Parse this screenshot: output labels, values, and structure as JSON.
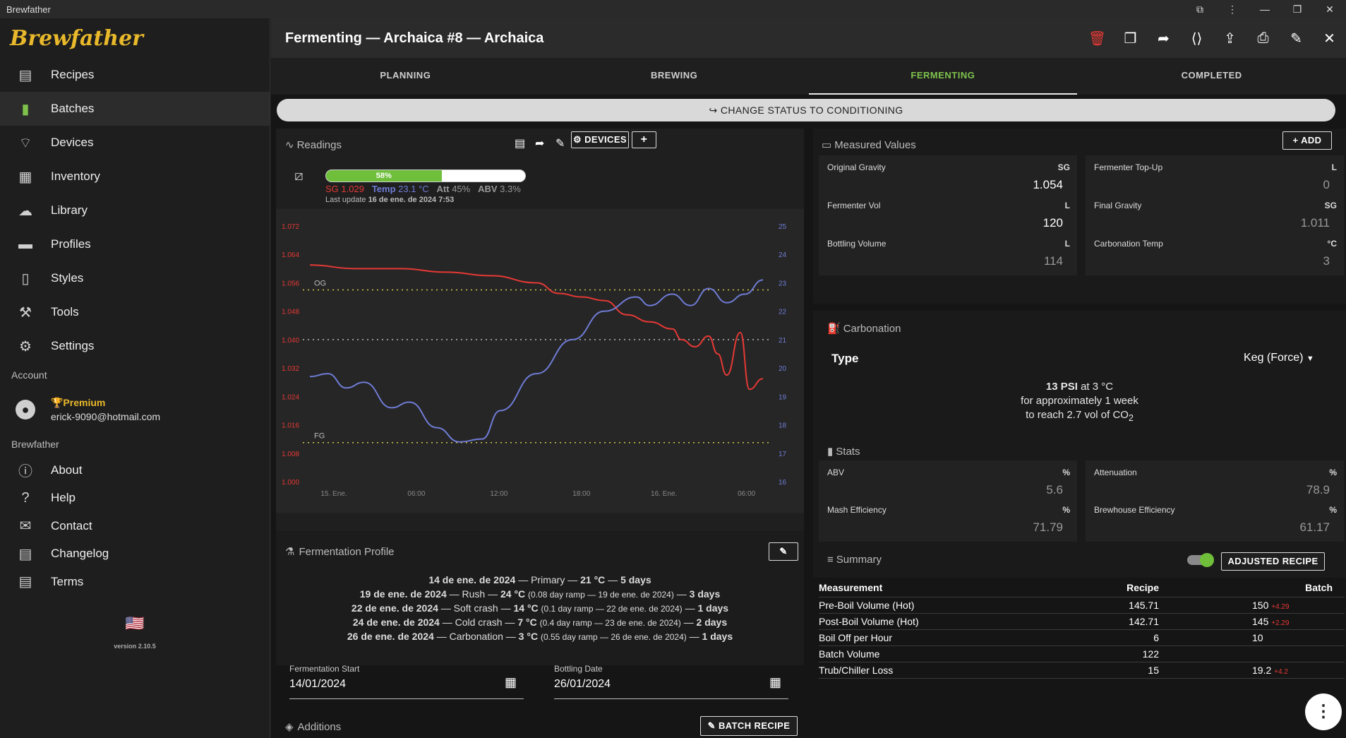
{
  "window": {
    "title": "Brewfather",
    "controls": [
      "—",
      "❐",
      "✕"
    ]
  },
  "sidebar": {
    "logo": "Brewfather",
    "items": [
      {
        "label": "Recipes",
        "icon": "recipes-icon"
      },
      {
        "label": "Batches",
        "icon": "batches-icon"
      },
      {
        "label": "Devices",
        "icon": "wifi-icon"
      },
      {
        "label": "Inventory",
        "icon": "inventory-icon"
      },
      {
        "label": "Library",
        "icon": "cloud-icon"
      },
      {
        "label": "Profiles",
        "icon": "profiles-icon"
      },
      {
        "label": "Styles",
        "icon": "book-icon"
      },
      {
        "label": "Tools",
        "icon": "tools-icon"
      },
      {
        "label": "Settings",
        "icon": "gear-icon"
      }
    ],
    "account_label": "Account",
    "premium": "🏆Premium",
    "email": "erick-9090@hotmail.com",
    "brewfather_label": "Brewfather",
    "info_items": [
      {
        "label": "About"
      },
      {
        "label": "Help"
      },
      {
        "label": "Contact"
      },
      {
        "label": "Changelog"
      },
      {
        "label": "Terms"
      }
    ],
    "version": "version 2.10.5"
  },
  "header": {
    "title": "Fermenting — Archaica #8 — Archaica"
  },
  "tabs": [
    "PLANNING",
    "BREWING",
    "FERMENTING",
    "COMPLETED"
  ],
  "status_button": "CHANGE STATUS TO CONDITIONING",
  "readings": {
    "title": "Readings",
    "devices_label": "DEVICES",
    "progress": 58,
    "progress_label": "58%",
    "sg_label": "SG",
    "sg": "1.029",
    "temp_label": "Temp",
    "temp": "23.1 °C",
    "att_label": "Att",
    "att": "45%",
    "abv_label": "ABV",
    "abv": "3.3%",
    "last_update_label": "Last update",
    "last_update": "16 de ene. de 2024 7:53"
  },
  "chart_data": {
    "type": "line",
    "x_ticks": [
      "15. Ene.",
      "06:00",
      "12:00",
      "18:00",
      "16. Ene.",
      "06:00"
    ],
    "y_left_ticks": [
      "1.072",
      "1.064",
      "1.056",
      "1.048",
      "1.040",
      "1.032",
      "1.024",
      "1.016",
      "1.008",
      "1.000"
    ],
    "y_right_ticks": [
      "25",
      "24",
      "23",
      "22",
      "21",
      "20",
      "19",
      "18",
      "17",
      "16"
    ],
    "ylim_left": [
      1.0,
      1.072
    ],
    "ylim_right": [
      16,
      25
    ],
    "reference_lines": [
      {
        "label": "OG",
        "value": 1.054
      },
      {
        "label": "FG",
        "value": 1.011
      }
    ],
    "series": [
      {
        "name": "SG",
        "color": "#e53935",
        "axis": "left",
        "x": [
          0,
          0.1,
          0.2,
          0.3,
          0.4,
          0.5,
          0.55,
          0.6,
          0.65,
          0.7,
          0.75,
          0.8,
          0.82,
          0.85,
          0.88,
          0.9,
          0.92,
          0.95,
          0.97,
          1.0
        ],
        "values": [
          1.061,
          1.06,
          1.06,
          1.059,
          1.058,
          1.056,
          1.053,
          1.052,
          1.051,
          1.047,
          1.045,
          1.043,
          1.04,
          1.038,
          1.041,
          1.036,
          1.03,
          1.042,
          1.026,
          1.029
        ]
      },
      {
        "name": "Temp",
        "color": "#6f7cd6",
        "axis": "right",
        "x": [
          0,
          0.04,
          0.08,
          0.12,
          0.18,
          0.22,
          0.28,
          0.33,
          0.38,
          0.42,
          0.5,
          0.58,
          0.65,
          0.72,
          0.75,
          0.8,
          0.84,
          0.88,
          0.92,
          0.96,
          1.0
        ],
        "values": [
          19.7,
          19.8,
          19.3,
          19.5,
          18.6,
          18.8,
          17.9,
          17.4,
          17.5,
          18.5,
          19.8,
          21.0,
          22.0,
          22.5,
          22.2,
          22.6,
          22.2,
          22.8,
          22.3,
          22.6,
          23.1
        ]
      }
    ]
  },
  "fermentation": {
    "title": "Fermentation Profile",
    "steps": [
      {
        "date": "14 de ene. de 2024",
        "name": "Primary",
        "temp": "21 °C",
        "ramp": "",
        "duration": "5 days"
      },
      {
        "date": "19 de ene. de 2024",
        "name": "Rush",
        "temp": "24 °C",
        "ramp": "(0.08 day ramp — 19 de ene. de 2024)",
        "duration": "3 days"
      },
      {
        "date": "22 de ene. de 2024",
        "name": "Soft crash",
        "temp": "14 °C",
        "ramp": "(0.1 day ramp — 22 de ene. de 2024)",
        "duration": "1 days"
      },
      {
        "date": "24 de ene. de 2024",
        "name": "Cold crash",
        "temp": "7 °C",
        "ramp": "(0.4 day ramp — 23 de ene. de 2024)",
        "duration": "2 days"
      },
      {
        "date": "26 de ene. de 2024",
        "name": "Carbonation",
        "temp": "3 °C",
        "ramp": "(0.55 day ramp — 26 de ene. de 2024)",
        "duration": "1 days"
      }
    ],
    "start_label": "Fermentation Start",
    "start": "14/01/2024",
    "bottling_label": "Bottling Date",
    "bottling": "26/01/2024"
  },
  "additions": {
    "title": "Additions",
    "batch_recipe": "BATCH RECIPE"
  },
  "measured": {
    "title": "Measured Values",
    "add_label": "ADD",
    "fields": [
      {
        "label": "Original Gravity",
        "unit": "SG",
        "value": "1.054"
      },
      {
        "label": "Fermenter Top-Up",
        "unit": "L",
        "value": "0"
      },
      {
        "label": "Fermenter Vol",
        "unit": "L",
        "value": "120"
      },
      {
        "label": "Final Gravity",
        "unit": "SG",
        "value": "1.011"
      },
      {
        "label": "Bottling Volume",
        "unit": "L",
        "value": "114"
      },
      {
        "label": "Carbonation Temp",
        "unit": "°C",
        "value": "3"
      }
    ]
  },
  "carbonation": {
    "title": "Carbonation",
    "type_label": "Type",
    "type_value": "Keg (Force)",
    "psi": "13 PSI",
    "at": "at 3 °C",
    "line2": "for approximately 1 week",
    "line3": "to reach 2.7 vol of CO",
    "sub": "2"
  },
  "stats": {
    "title": "Stats",
    "fields": [
      {
        "label": "ABV",
        "unit": "%",
        "value": "5.6"
      },
      {
        "label": "Attenuation",
        "unit": "%",
        "value": "78.9"
      },
      {
        "label": "Mash Efficiency",
        "unit": "%",
        "value": "71.79"
      },
      {
        "label": "Brewhouse Efficiency",
        "unit": "%",
        "value": "61.17"
      }
    ]
  },
  "summary": {
    "title": "Summary",
    "adjusted_label": "ADJUSTED RECIPE",
    "headers": [
      "Measurement",
      "Recipe",
      "Batch"
    ],
    "rows": [
      {
        "m": "Pre-Boil Volume",
        "hot": " (Hot)",
        "r": "145.71",
        "b": "150",
        "d": "+4.29"
      },
      {
        "m": "Post-Boil Volume",
        "hot": " (Hot)",
        "r": "142.71",
        "b": "145",
        "d": "+2.29"
      },
      {
        "m": "Boil Off per Hour",
        "hot": "",
        "r": "6",
        "b": "10",
        "d": ""
      },
      {
        "m": "Batch Volume",
        "hot": "",
        "r": "122",
        "b": "",
        "d": ""
      },
      {
        "m": "Trub/Chiller Loss",
        "hot": "",
        "r": "15",
        "b": "19.2",
        "d": "+4.2"
      }
    ]
  }
}
